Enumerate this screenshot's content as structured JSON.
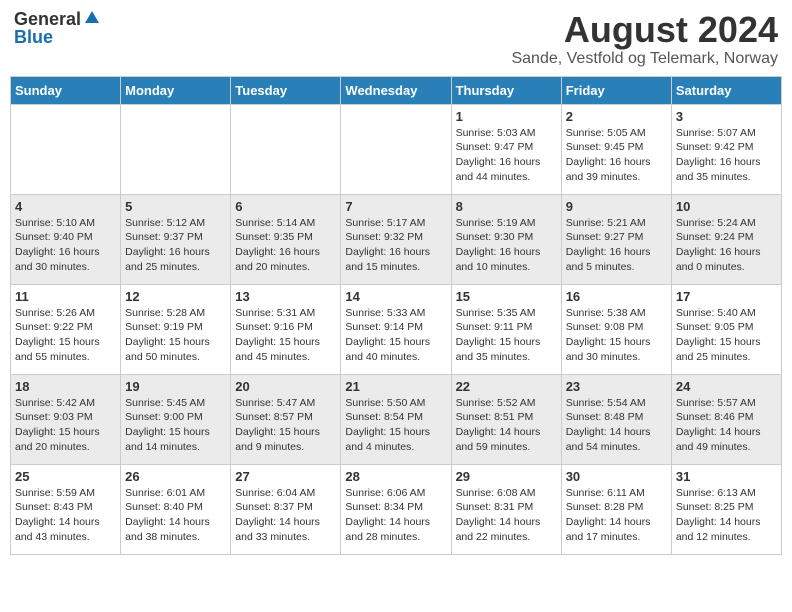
{
  "header": {
    "logo_general": "General",
    "logo_blue": "Blue",
    "month_year": "August 2024",
    "location": "Sande, Vestfold og Telemark, Norway"
  },
  "weekdays": [
    "Sunday",
    "Monday",
    "Tuesday",
    "Wednesday",
    "Thursday",
    "Friday",
    "Saturday"
  ],
  "weeks": [
    [
      {
        "day": "",
        "info": ""
      },
      {
        "day": "",
        "info": ""
      },
      {
        "day": "",
        "info": ""
      },
      {
        "day": "",
        "info": ""
      },
      {
        "day": "1",
        "info": "Sunrise: 5:03 AM\nSunset: 9:47 PM\nDaylight: 16 hours\nand 44 minutes."
      },
      {
        "day": "2",
        "info": "Sunrise: 5:05 AM\nSunset: 9:45 PM\nDaylight: 16 hours\nand 39 minutes."
      },
      {
        "day": "3",
        "info": "Sunrise: 5:07 AM\nSunset: 9:42 PM\nDaylight: 16 hours\nand 35 minutes."
      }
    ],
    [
      {
        "day": "4",
        "info": "Sunrise: 5:10 AM\nSunset: 9:40 PM\nDaylight: 16 hours\nand 30 minutes."
      },
      {
        "day": "5",
        "info": "Sunrise: 5:12 AM\nSunset: 9:37 PM\nDaylight: 16 hours\nand 25 minutes."
      },
      {
        "day": "6",
        "info": "Sunrise: 5:14 AM\nSunset: 9:35 PM\nDaylight: 16 hours\nand 20 minutes."
      },
      {
        "day": "7",
        "info": "Sunrise: 5:17 AM\nSunset: 9:32 PM\nDaylight: 16 hours\nand 15 minutes."
      },
      {
        "day": "8",
        "info": "Sunrise: 5:19 AM\nSunset: 9:30 PM\nDaylight: 16 hours\nand 10 minutes."
      },
      {
        "day": "9",
        "info": "Sunrise: 5:21 AM\nSunset: 9:27 PM\nDaylight: 16 hours\nand 5 minutes."
      },
      {
        "day": "10",
        "info": "Sunrise: 5:24 AM\nSunset: 9:24 PM\nDaylight: 16 hours\nand 0 minutes."
      }
    ],
    [
      {
        "day": "11",
        "info": "Sunrise: 5:26 AM\nSunset: 9:22 PM\nDaylight: 15 hours\nand 55 minutes."
      },
      {
        "day": "12",
        "info": "Sunrise: 5:28 AM\nSunset: 9:19 PM\nDaylight: 15 hours\nand 50 minutes."
      },
      {
        "day": "13",
        "info": "Sunrise: 5:31 AM\nSunset: 9:16 PM\nDaylight: 15 hours\nand 45 minutes."
      },
      {
        "day": "14",
        "info": "Sunrise: 5:33 AM\nSunset: 9:14 PM\nDaylight: 15 hours\nand 40 minutes."
      },
      {
        "day": "15",
        "info": "Sunrise: 5:35 AM\nSunset: 9:11 PM\nDaylight: 15 hours\nand 35 minutes."
      },
      {
        "day": "16",
        "info": "Sunrise: 5:38 AM\nSunset: 9:08 PM\nDaylight: 15 hours\nand 30 minutes."
      },
      {
        "day": "17",
        "info": "Sunrise: 5:40 AM\nSunset: 9:05 PM\nDaylight: 15 hours\nand 25 minutes."
      }
    ],
    [
      {
        "day": "18",
        "info": "Sunrise: 5:42 AM\nSunset: 9:03 PM\nDaylight: 15 hours\nand 20 minutes."
      },
      {
        "day": "19",
        "info": "Sunrise: 5:45 AM\nSunset: 9:00 PM\nDaylight: 15 hours\nand 14 minutes."
      },
      {
        "day": "20",
        "info": "Sunrise: 5:47 AM\nSunset: 8:57 PM\nDaylight: 15 hours\nand 9 minutes."
      },
      {
        "day": "21",
        "info": "Sunrise: 5:50 AM\nSunset: 8:54 PM\nDaylight: 15 hours\nand 4 minutes."
      },
      {
        "day": "22",
        "info": "Sunrise: 5:52 AM\nSunset: 8:51 PM\nDaylight: 14 hours\nand 59 minutes."
      },
      {
        "day": "23",
        "info": "Sunrise: 5:54 AM\nSunset: 8:48 PM\nDaylight: 14 hours\nand 54 minutes."
      },
      {
        "day": "24",
        "info": "Sunrise: 5:57 AM\nSunset: 8:46 PM\nDaylight: 14 hours\nand 49 minutes."
      }
    ],
    [
      {
        "day": "25",
        "info": "Sunrise: 5:59 AM\nSunset: 8:43 PM\nDaylight: 14 hours\nand 43 minutes."
      },
      {
        "day": "26",
        "info": "Sunrise: 6:01 AM\nSunset: 8:40 PM\nDaylight: 14 hours\nand 38 minutes."
      },
      {
        "day": "27",
        "info": "Sunrise: 6:04 AM\nSunset: 8:37 PM\nDaylight: 14 hours\nand 33 minutes."
      },
      {
        "day": "28",
        "info": "Sunrise: 6:06 AM\nSunset: 8:34 PM\nDaylight: 14 hours\nand 28 minutes."
      },
      {
        "day": "29",
        "info": "Sunrise: 6:08 AM\nSunset: 8:31 PM\nDaylight: 14 hours\nand 22 minutes."
      },
      {
        "day": "30",
        "info": "Sunrise: 6:11 AM\nSunset: 8:28 PM\nDaylight: 14 hours\nand 17 minutes."
      },
      {
        "day": "31",
        "info": "Sunrise: 6:13 AM\nSunset: 8:25 PM\nDaylight: 14 hours\nand 12 minutes."
      }
    ]
  ]
}
